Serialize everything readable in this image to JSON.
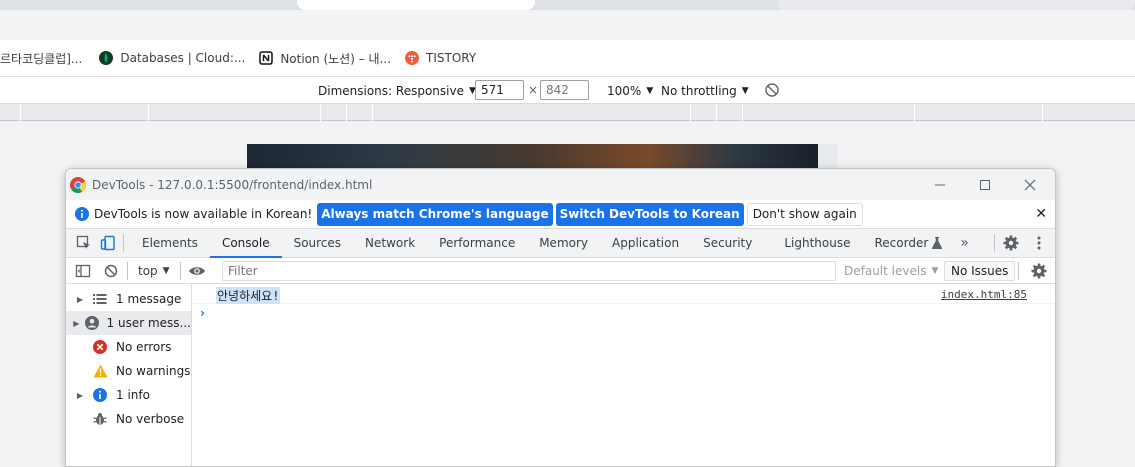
{
  "browser": {
    "bookmarks": [
      {
        "label": "르타코딩클럽]...",
        "icon": "bookmark-icon"
      },
      {
        "label": "Databases | Cloud:...",
        "icon": "mongodb-leaf-icon"
      },
      {
        "label": "Notion (노션) – 내...",
        "icon": "notion-icon"
      },
      {
        "label": "TISTORY",
        "icon": "tistory-icon"
      }
    ]
  },
  "device_toolbar": {
    "dimensions_label": "Dimensions: Responsive",
    "width_value": "571",
    "height_placeholder": "842",
    "times": "×",
    "zoom_label": "100%",
    "throttling_label": "No throttling"
  },
  "devtools": {
    "title": "DevTools - 127.0.0.1:5500/frontend/index.html",
    "infobar": {
      "message": "DevTools is now available in Korean!",
      "match_button": "Always match Chrome's language",
      "switch_button": "Switch DevTools to Korean",
      "dismiss_button": "Don't show again"
    },
    "tabs": [
      {
        "label": "Elements"
      },
      {
        "label": "Console"
      },
      {
        "label": "Sources"
      },
      {
        "label": "Network"
      },
      {
        "label": "Performance"
      },
      {
        "label": "Memory"
      },
      {
        "label": "Application"
      },
      {
        "label": "Security"
      },
      {
        "label": "Lighthouse"
      },
      {
        "label": "Recorder"
      }
    ],
    "active_tab": "Console",
    "console_toolbar": {
      "context": "top",
      "filter_placeholder": "Filter",
      "levels": "Default levels",
      "issues": "No Issues"
    },
    "sidebar": [
      {
        "label": "1 message",
        "icon": "list-icon",
        "expandable": true
      },
      {
        "label": "1 user mess...",
        "icon": "user-icon",
        "expandable": true
      },
      {
        "label": "No errors",
        "icon": "error-icon",
        "expandable": false
      },
      {
        "label": "No warnings",
        "icon": "warning-icon",
        "expandable": false
      },
      {
        "label": "1 info",
        "icon": "info-icon",
        "expandable": true
      },
      {
        "label": "No verbose",
        "icon": "bug-icon",
        "expandable": false
      }
    ],
    "messages": [
      {
        "text": "안녕하세요!",
        "source": "index.html:85"
      }
    ],
    "prompt": "›"
  },
  "colors": {
    "accent": "#1a73e8",
    "error": "#d93025",
    "warning": "#f9ab00",
    "info": "#1a73e8"
  }
}
